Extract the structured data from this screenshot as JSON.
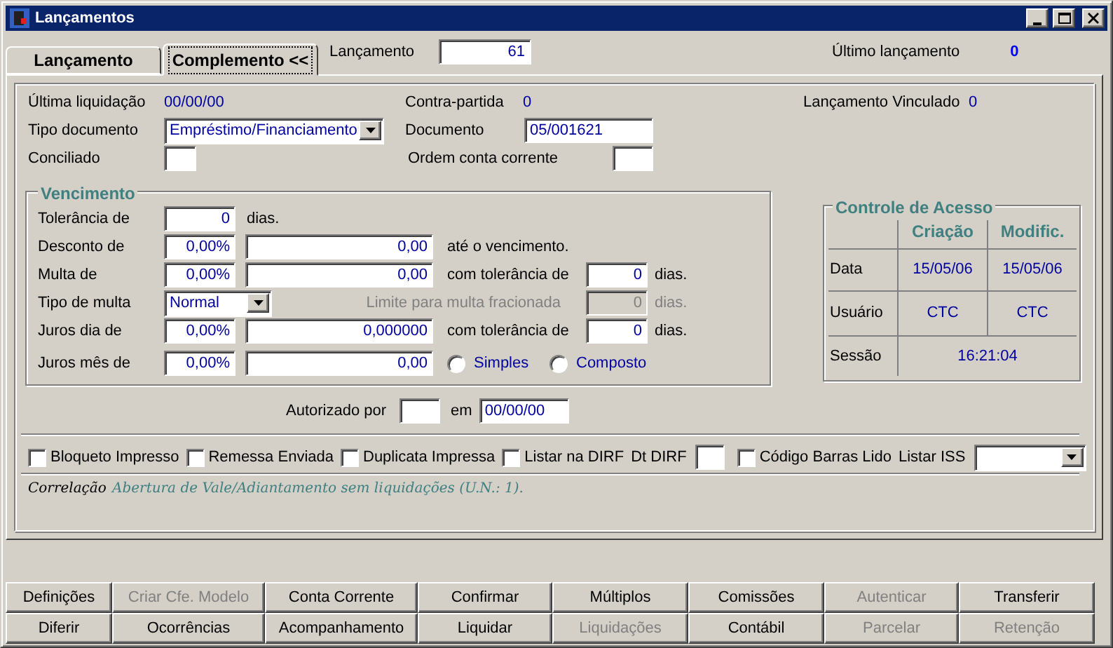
{
  "window": {
    "title": "Lançamentos"
  },
  "tabs": [
    {
      "label": "Lançamento",
      "selected": false
    },
    {
      "label": "Complemento <<",
      "selected": true
    }
  ],
  "header": {
    "lancamento_label": "Lançamento",
    "lancamento_value": "61",
    "ultimo_label": "Último lançamento",
    "ultimo_value": "0"
  },
  "general": {
    "ultima_liquidacao_label": "Última liquidação",
    "ultima_liquidacao": "00/00/00",
    "contra_partida_label": "Contra-partida",
    "contra_partida": "0",
    "vinculado_label": "Lançamento Vinculado",
    "vinculado": "0",
    "tipo_documento_label": "Tipo documento",
    "tipo_documento": "Empréstimo/Financiamento",
    "documento_label": "Documento",
    "documento": "05/001621",
    "conciliado_label": "Conciliado",
    "ordem_label": "Ordem conta corrente"
  },
  "vencimento": {
    "title": "Vencimento",
    "rows": [
      {
        "kind": "tolerance",
        "label": "Tolerância de",
        "value": "0",
        "unit": "dias."
      },
      {
        "kind": "percent",
        "label": "Desconto de",
        "percent": "0,00%",
        "amount": "0,00",
        "suffix": "até o vencimento."
      },
      {
        "kind": "percent_days",
        "label": "Multa de",
        "percent": "0,00%",
        "amount": "0,00",
        "suffix": "com tolerância de",
        "days": "0",
        "unit": "dias."
      },
      {
        "kind": "select",
        "label": "Tipo de multa",
        "value": "Normal",
        "limit_label": "Limite para multa fracionada",
        "limit_value": "0",
        "unit": "dias.",
        "disabled": true
      },
      {
        "kind": "percent_days",
        "label": "Juros dia de",
        "percent": "0,00%",
        "amount": "0,000000",
        "suffix": "com tolerância de",
        "days": "0",
        "unit": "dias."
      },
      {
        "kind": "percent_radio",
        "label": "Juros mês de",
        "percent": "0,00%",
        "amount": "0,00",
        "options": [
          {
            "label": "Simples",
            "selected": false
          },
          {
            "label": "Composto",
            "selected": false
          }
        ]
      }
    ]
  },
  "controle_acesso": {
    "title": "Controle de Acesso",
    "columns": [
      "Criação",
      "Modific."
    ],
    "rows": [
      {
        "label": "Data",
        "values": [
          "15/05/06",
          "15/05/06"
        ]
      },
      {
        "label": "Usuário",
        "values": [
          "CTC",
          "CTC"
        ]
      },
      {
        "label": "Sessão",
        "values": [
          "16:21:04"
        ]
      }
    ]
  },
  "autorizacao": {
    "label": "Autorizado por",
    "em_label": "em",
    "date": "00/00/00"
  },
  "flags": [
    {
      "kind": "checkbox",
      "label": "Bloqueto Impresso",
      "checked": false
    },
    {
      "kind": "checkbox",
      "label": "Remessa Enviada",
      "checked": false
    },
    {
      "kind": "checkbox",
      "label": "Duplicata Impressa",
      "checked": false
    },
    {
      "kind": "checkbox",
      "label": "Listar na DIRF",
      "checked": false
    },
    {
      "kind": "field",
      "label": "Dt DIRF"
    },
    {
      "kind": "checkbox",
      "label": "Código Barras Lido",
      "checked": false
    },
    {
      "kind": "select",
      "label": "Listar ISS"
    }
  ],
  "correlacao": {
    "label": "Correlação",
    "text": "Abertura de Vale/Adiantamento sem liquidações (U.N.: 1)."
  },
  "buttons": [
    [
      {
        "label": "Definições",
        "disabled": false
      },
      {
        "label": "Criar Cfe. Modelo",
        "disabled": true
      },
      {
        "label": "Conta Corrente",
        "disabled": false
      },
      {
        "label": "Confirmar",
        "disabled": false
      },
      {
        "label": "Múltiplos",
        "disabled": false
      },
      {
        "label": "Comissões",
        "disabled": false
      },
      {
        "label": "Autenticar",
        "disabled": true
      },
      {
        "label": "Transferir",
        "disabled": false
      }
    ],
    [
      {
        "label": "Diferir",
        "disabled": false
      },
      {
        "label": "Ocorrências",
        "disabled": false
      },
      {
        "label": "Acompanhamento",
        "disabled": false
      },
      {
        "label": "Liquidar",
        "disabled": false
      },
      {
        "label": "Liquidações",
        "disabled": true
      },
      {
        "label": "Contábil",
        "disabled": false
      },
      {
        "label": "Parcelar",
        "disabled": true
      },
      {
        "label": "Retenção",
        "disabled": true
      }
    ]
  ]
}
